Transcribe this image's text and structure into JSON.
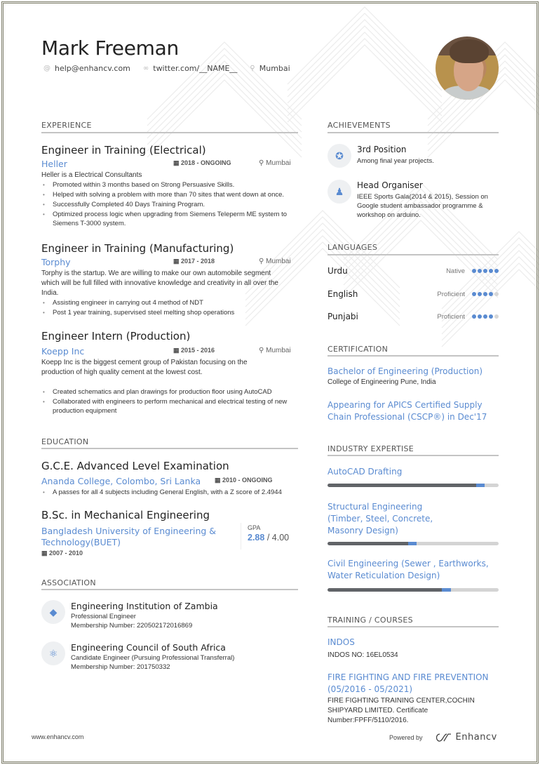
{
  "header": {
    "name": "Mark Freeman",
    "contacts": [
      {
        "icon": "at-icon",
        "glyph": "@",
        "text": "help@enhancv.com"
      },
      {
        "icon": "link-icon",
        "glyph": "∞",
        "text": "twitter.com/__NAME__"
      },
      {
        "icon": "location-icon",
        "glyph": "⚲",
        "text": "Mumbai"
      }
    ]
  },
  "experience": {
    "title": "EXPERIENCE",
    "items": [
      {
        "role": "Engineer in Training (Electrical)",
        "company": "Heller",
        "date": "2018 - ONGOING",
        "location": "Mumbai",
        "description": "Heller is a Electrical Consultants",
        "bullets": [
          "Promoted within 3 months based on Strong Persuasive Skills.",
          "Helped with solving a problem with more than 70 sites that went down at once.",
          "Successfully Completed 40 Days Training Program.",
          "Optimized process logic when upgrading from Siemens Teleperm ME system to Siemens T-3000 system."
        ]
      },
      {
        "role": "Engineer in Training (Manufacturing)",
        "company": "Torphy",
        "date": "2017 - 2018",
        "location": "Mumbai",
        "description": "Torphy is the startup. We are willing to make our own automobile segment which will be full filled with innovative knowledge and creativity in all over the India.",
        "bullets": [
          "Assisting engineer in carrying out 4 method of NDT",
          "Post 1 year training, supervised steel melting shop operations"
        ]
      },
      {
        "role": "Engineer Intern (Production)",
        "company": "Koepp Inc",
        "date": "2015 - 2016",
        "location": "Mumbai",
        "description": "Koepp Inc is the biggest cement group of Pakistan focusing on the production of high quality cement at the lowest cost.",
        "bullets": [
          "Created schematics and plan drawings for production floor using AutoCAD",
          "Collaborated with engineers to perform mechanical and electrical testing of new production equipment"
        ]
      }
    ]
  },
  "education": {
    "title": "EDUCATION",
    "items": [
      {
        "degree": "G.C.E. Advanced Level Examination",
        "school": "Ananda College, Colombo, Sri Lanka",
        "date": "2010 - ONGOING",
        "bullets": [
          "A passes for all 4 subjects including General English, with a Z score of 2.4944"
        ]
      },
      {
        "degree": "B.Sc. in Mechanical Engineering",
        "school": "Bangladesh University of Engineering & Technology(BUET)",
        "date": "2007 - 2010",
        "gpa_label": "GPA",
        "gpa": "2.88",
        "gpa_sep": "/",
        "gpa_max": "4.00"
      }
    ]
  },
  "association": {
    "title": "ASSOCIATION",
    "items": [
      {
        "icon": "diamond-icon",
        "name": "Engineering Institution of Zambia",
        "role": "Professional Engineer",
        "membership": "Membership Number: 220502172016869"
      },
      {
        "icon": "atom-icon",
        "name": "Engineering Council of South Africa",
        "role": "Candidate Engineer (Pursuing Professional Transferral)",
        "membership": "Membership Number: 201750332"
      }
    ]
  },
  "achievements": {
    "title": "ACHIEVEMENTS",
    "items": [
      {
        "icon": "award-icon",
        "title": "3rd Position",
        "text": "Among final year projects."
      },
      {
        "icon": "person-icon",
        "title": "Head Organiser",
        "text": "IEEE Sports Gala(2014 & 2015), Session on Google student ambassador programme & workshop on arduino."
      }
    ]
  },
  "languages": {
    "title": "LANGUAGES",
    "items": [
      {
        "name": "Urdu",
        "level": "Native",
        "rating": 5,
        "max": 5
      },
      {
        "name": "English",
        "level": "Proficient",
        "rating": 4,
        "max": 5
      },
      {
        "name": "Punjabi",
        "level": "Proficient",
        "rating": 4,
        "max": 5
      }
    ]
  },
  "certification": {
    "title": "CERTIFICATION",
    "items": [
      {
        "title": "Bachelor of Engineering (Production)",
        "subtitle": "College of Engineering Pune, India"
      },
      {
        "title": "Appearing  for APICS Certified Supply Chain Professional (CSCP®) in Dec'17",
        "subtitle": ""
      }
    ]
  },
  "expertise": {
    "title": "INDUSTRY EXPERTISE",
    "items": [
      {
        "name": "AutoCAD Drafting",
        "level_percent": 92
      },
      {
        "name": "Structural Engineering (Timber, Steel, Concrete, Masonry Design)",
        "level_percent": 52
      },
      {
        "name": "Civil Engineering (Sewer , Earthworks, Water Reticulation Design)",
        "level_percent": 72
      }
    ]
  },
  "training": {
    "title": "TRAINING / COURSES",
    "items": [
      {
        "title": "INDOS",
        "text": "INDOS NO: 16EL0534"
      },
      {
        "title": "FIRE FIGHTING AND FIRE PREVENTION (05/2016 - 05/2021)",
        "text": "FIRE FIGHTING TRAINING CENTER,COCHIN SHIPYARD LIMITED.  Certificate Number:FPFF/5110/2016."
      }
    ]
  },
  "footer": {
    "website": "www.enhancv.com",
    "powered_by": "Powered by",
    "brand": "Enhancv"
  },
  "colors": {
    "accent": "#5a8bd1",
    "bar_dark": "#616468",
    "bar_track": "#d4d4d4"
  }
}
